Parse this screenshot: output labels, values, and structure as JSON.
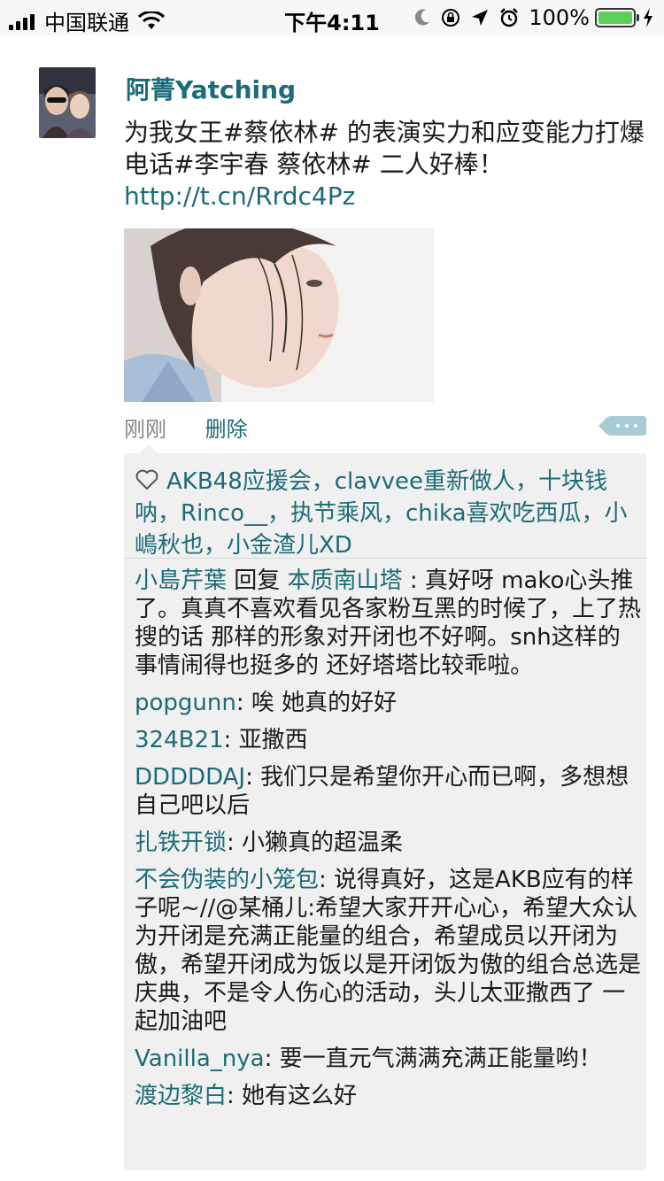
{
  "status_bar": {
    "carrier": "中国联通",
    "time": "下午4:11",
    "battery": "100%"
  },
  "post": {
    "username": "阿菁Yatching",
    "text": "为我女王#蔡依林# 的表演实力和应变能力打爆电话#李宇春 蔡依林# 二人好棒！ ",
    "link": "http://t.cn/Rrdc4Pz",
    "time": "刚刚",
    "delete_label": "删除"
  },
  "likes": {
    "text": "AKB48应援会，clavvee重新做人，十块钱呐，Rinco__，执节乘风，chika喜欢吃西瓜，小嶋秋也，小金渣儿XD"
  },
  "comments": [
    {
      "user": "小島芹葉",
      "mid": " 回复 ",
      "reply_to": "本质南山塔",
      "text": " : 真好呀 mako心头推了。真真不喜欢看见各家粉互黑的时候了，上了热搜的话 那样的形象对开闭也不好啊。snh这样的事情闹得也挺多的 还好塔塔比较乖啦。"
    },
    {
      "user": "popgunn",
      "text": ": 唉 她真的好好"
    },
    {
      "user": "324B21",
      "text": ": 亚撒西"
    },
    {
      "user": "DDDDDAJ",
      "text": ": 我们只是希望你开心而已啊，多想想自己吧以后"
    },
    {
      "user": "扎铁开锁",
      "text": ": 小獭真的超温柔"
    },
    {
      "user": "不会伪装的小笼包",
      "text": ": 说得真好，这是AKB应有的样子呢~//@某桶儿:希望大家开开心心，希望大众认为开闭是充满正能量的组合，希望成员以开闭为傲，希望开闭成为饭以是开闭饭为傲的组合总选是庆典，不是令人伤心的活动，头儿太亚撒西了 一起加油吧"
    },
    {
      "user": "Vanilla_nya",
      "text": ": 要一直元气满满充满正能量哟！"
    },
    {
      "user": "渡边黎白",
      "text": ": 她有这么好"
    }
  ]
}
